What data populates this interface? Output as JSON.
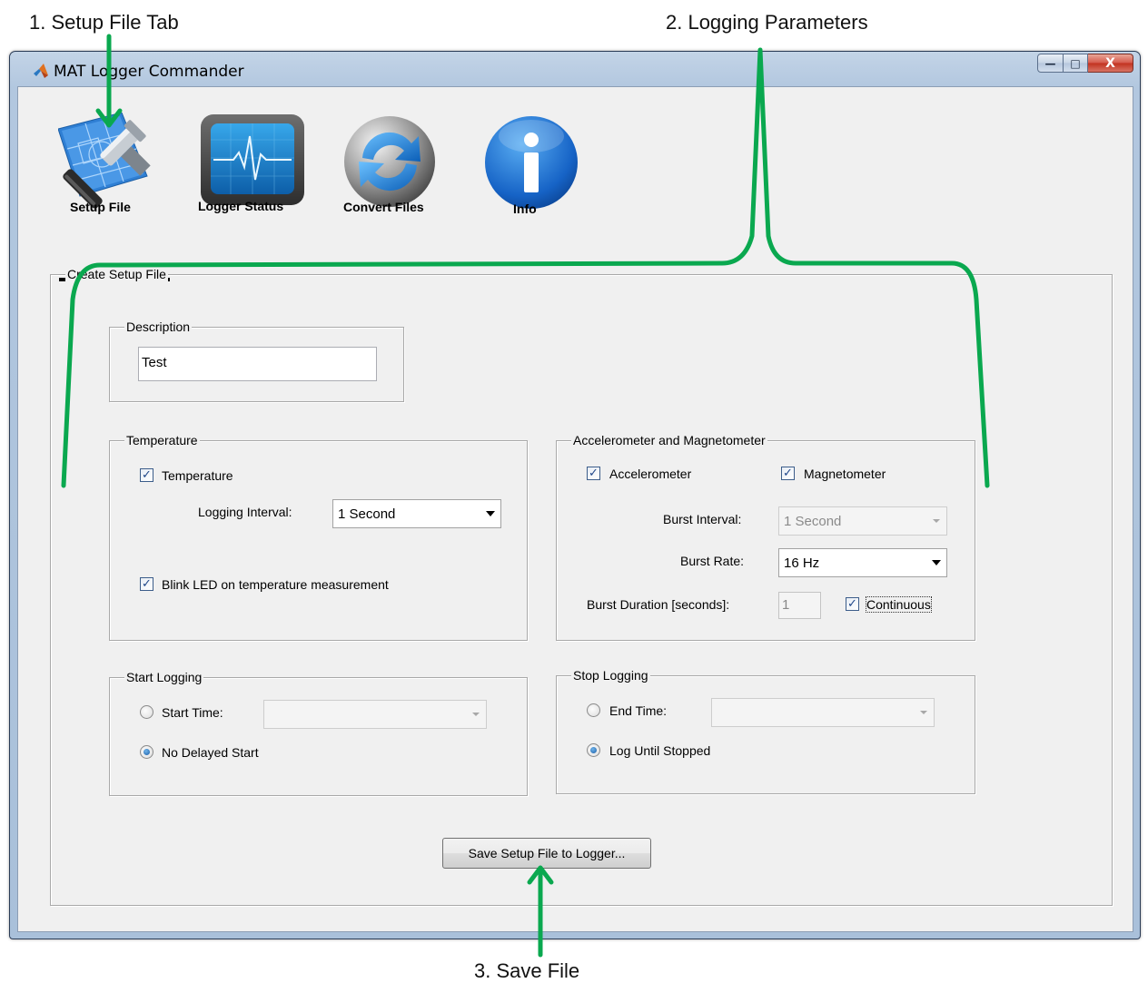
{
  "callouts": {
    "setup_tab": "1. Setup File Tab",
    "logging_params": "2. Logging Parameters",
    "save_file": "3. Save File",
    "color": "#0aa84f"
  },
  "window": {
    "title": "MAT Logger Commander",
    "app_icon": "matlab-icon",
    "controls": {
      "minimize": "—",
      "maximize": "□",
      "close": "X"
    }
  },
  "toolbar": [
    {
      "label": "Setup File",
      "icon": "hammer-blueprint-icon",
      "selected": true
    },
    {
      "label": "Logger Status",
      "icon": "monitor-heartbeat-icon",
      "selected": false
    },
    {
      "label": "Convert Files",
      "icon": "refresh-icon",
      "selected": false
    },
    {
      "label": "Info",
      "icon": "info-icon",
      "selected": false
    }
  ],
  "setup_panel": {
    "title": "Create Setup File",
    "description": {
      "title": "Description",
      "value": "Test"
    },
    "temperature": {
      "title": "Temperature",
      "enable_label": "Temperature",
      "enable_checked": true,
      "interval_label": "Logging Interval:",
      "interval_value": "1 Second",
      "blink_label": "Blink LED on temperature measurement",
      "blink_checked": true
    },
    "accel_mag": {
      "title": "Accelerometer and Magnetometer",
      "accel_label": "Accelerometer",
      "accel_checked": true,
      "mag_label": "Magnetometer",
      "mag_checked": true,
      "burst_interval_label": "Burst Interval:",
      "burst_interval_value": "1 Second",
      "burst_rate_label": "Burst Rate:",
      "burst_rate_value": "16 Hz",
      "burst_duration_label": "Burst Duration [seconds]:",
      "burst_duration_value": "1",
      "continuous_label": "Continuous",
      "continuous_checked": true
    },
    "start_logging": {
      "title": "Start Logging",
      "start_time_label": "Start Time:",
      "no_delay_label": "No Delayed Start",
      "selected": "no_delay"
    },
    "stop_logging": {
      "title": "Stop Logging",
      "end_time_label": "End Time:",
      "until_stopped_label": "Log Until Stopped",
      "selected": "until_stopped"
    },
    "save_button": "Save Setup File to Logger..."
  }
}
